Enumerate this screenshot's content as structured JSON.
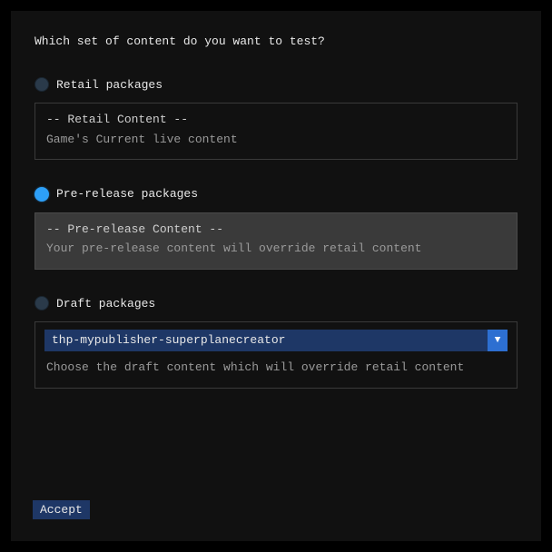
{
  "question": "Which set of content do you want to test?",
  "options": {
    "retail": {
      "label": "Retail packages",
      "title": "-- Retail Content --",
      "desc": "Game's Current live content",
      "selected": false
    },
    "prerelease": {
      "label": "Pre-release packages",
      "title": "-- Pre-release Content --",
      "desc": "Your pre-release content will override retail content",
      "selected": true
    },
    "draft": {
      "label": "Draft packages",
      "selected_value": "thp-mypublisher-superplanecreator",
      "desc": "Choose the draft content which will override retail content",
      "selected": false
    }
  },
  "accept_label": "Accept",
  "chevron": "▼"
}
